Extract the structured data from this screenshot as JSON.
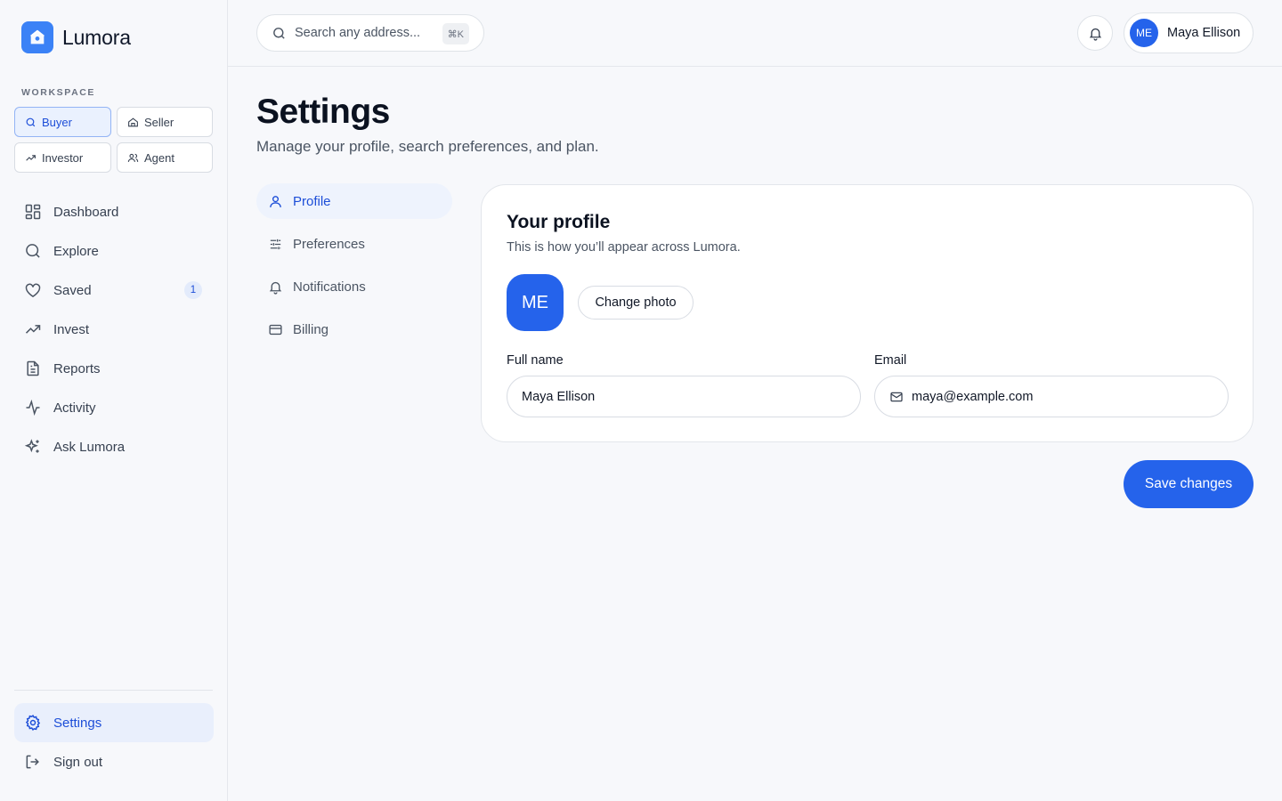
{
  "brand": {
    "name": "Lumora"
  },
  "workspace": {
    "label": "WORKSPACE",
    "options": [
      {
        "label": "Buyer",
        "icon": "search-icon",
        "active": true
      },
      {
        "label": "Seller",
        "icon": "home-icon",
        "active": false
      },
      {
        "label": "Investor",
        "icon": "trend-up-icon",
        "active": false
      },
      {
        "label": "Agent",
        "icon": "users-icon",
        "active": false
      }
    ]
  },
  "nav": {
    "items": [
      {
        "label": "Dashboard",
        "icon": "dashboard-icon"
      },
      {
        "label": "Explore",
        "icon": "search-icon"
      },
      {
        "label": "Saved",
        "icon": "heart-icon",
        "badge": "1"
      },
      {
        "label": "Invest",
        "icon": "trend-up-icon"
      },
      {
        "label": "Reports",
        "icon": "document-icon"
      },
      {
        "label": "Activity",
        "icon": "activity-icon"
      },
      {
        "label": "Ask Lumora",
        "icon": "sparkles-icon"
      }
    ],
    "settings_label": "Settings",
    "signout_label": "Sign out"
  },
  "topbar": {
    "search_placeholder": "Search any address...",
    "shortcut": "⌘K",
    "user": {
      "initials": "ME",
      "name": "Maya Ellison"
    }
  },
  "page": {
    "title": "Settings",
    "subtitle": "Manage your profile, search preferences, and plan."
  },
  "settings_nav": [
    {
      "label": "Profile",
      "icon": "user-icon",
      "active": true
    },
    {
      "label": "Preferences",
      "icon": "sliders-icon",
      "active": false
    },
    {
      "label": "Notifications",
      "icon": "bell-icon",
      "active": false
    },
    {
      "label": "Billing",
      "icon": "credit-card-icon",
      "active": false
    }
  ],
  "profile": {
    "title": "Your profile",
    "subtitle": "This is how you’ll appear across Lumora.",
    "initials": "ME",
    "change_photo": "Change photo",
    "full_name_label": "Full name",
    "full_name_value": "Maya Ellison",
    "email_label": "Email",
    "email_value": "maya@example.com"
  },
  "actions": {
    "save_label": "Save changes"
  },
  "colors": {
    "accent": "#2563eb",
    "accent_soft": "#e9effc",
    "background": "#f7f8fb"
  }
}
